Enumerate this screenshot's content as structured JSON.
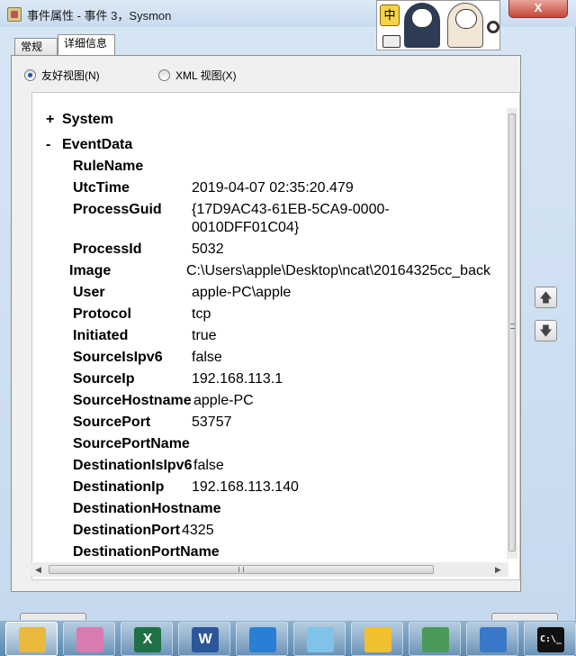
{
  "window": {
    "title": "事件属性 - 事件 3，Sysmon",
    "close_label": "X"
  },
  "ime_widget": {
    "mode_char": "中"
  },
  "tabs": [
    {
      "label": "常规",
      "selected": false
    },
    {
      "label": "详细信息",
      "selected": true
    }
  ],
  "view_options": {
    "friendly": {
      "label": "友好视图(N)",
      "checked": true
    },
    "xml": {
      "label": "XML 视图(X)",
      "checked": false
    }
  },
  "tree": {
    "system": {
      "sign": "+",
      "label": "System"
    },
    "eventdata": {
      "sign": "-",
      "label": "EventData"
    },
    "fields": [
      {
        "key": "RuleName",
        "value": ""
      },
      {
        "key": "UtcTime",
        "value": "2019-04-07 02:35:20.479"
      },
      {
        "key": "ProcessGuid",
        "value": "{17D9AC43-61EB-5CA9-0000-",
        "value2": "0010DFF01C04}"
      },
      {
        "key": "ProcessId",
        "value": "5032"
      },
      {
        "key": "Image",
        "value": "C:\\Users\\apple\\Desktop\\ncat\\20164325cc_back"
      },
      {
        "key": "User",
        "value": "apple-PC\\apple"
      },
      {
        "key": "Protocol",
        "value": "tcp"
      },
      {
        "key": "Initiated",
        "value": "true"
      },
      {
        "key": "SourceIsIpv6",
        "value": "false"
      },
      {
        "key": "SourceIp",
        "value": "192.168.113.1"
      },
      {
        "key": "SourceHostname",
        "value": "apple-PC"
      },
      {
        "key": "SourcePort",
        "value": "53757"
      },
      {
        "key": "SourcePortName",
        "value": ""
      },
      {
        "key": "DestinationIsIpv6",
        "value": "false"
      },
      {
        "key": "DestinationIp",
        "value": "192.168.113.140"
      },
      {
        "key": "DestinationHostname",
        "value": ""
      },
      {
        "key": "DestinationPort",
        "value": "4325"
      },
      {
        "key": "DestinationPortName",
        "value": ""
      }
    ]
  },
  "nav": {
    "up_icon": "arrow-up-icon",
    "down_icon": "arrow-down-icon"
  },
  "taskbar": {
    "items": [
      {
        "name": "file-explorer-icon",
        "glyph": "",
        "color": "#e8b93a"
      },
      {
        "name": "photo-viewer-icon",
        "glyph": "",
        "color": "#d97ab0"
      },
      {
        "name": "excel-icon",
        "glyph": "X",
        "color": "#1e7145"
      },
      {
        "name": "word-icon",
        "glyph": "W",
        "color": "#2b579a"
      },
      {
        "name": "network-icon",
        "glyph": "",
        "color": "#2a7fd4"
      },
      {
        "name": "notepad-icon",
        "glyph": "",
        "color": "#7fc4e8"
      },
      {
        "name": "clock-icon",
        "glyph": "",
        "color": "#f0c030"
      },
      {
        "name": "event-viewer-icon",
        "glyph": "",
        "color": "#4a9a5a"
      },
      {
        "name": "remote-desktop-icon",
        "glyph": "",
        "color": "#3a78c8"
      },
      {
        "name": "command-prompt-icon",
        "glyph": "C:\\_",
        "color": "#111111"
      }
    ]
  }
}
